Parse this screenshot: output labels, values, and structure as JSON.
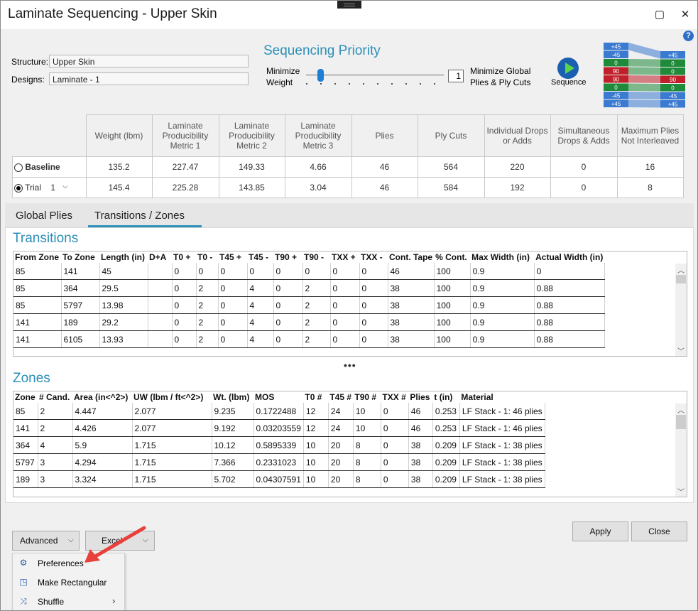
{
  "window": {
    "title": "Laminate Sequencing - Upper Skin"
  },
  "fields": {
    "structure_label": "Structure:",
    "structure_value": "Upper Skin",
    "designs_label": "Designs:",
    "designs_value": "Laminate - 1"
  },
  "priority": {
    "title": "Sequencing Priority",
    "left_label_1": "Minimize",
    "left_label_2": "Weight",
    "right_label_1": "Minimize Global",
    "right_label_2": "Plies & Ply Cuts",
    "slider_value": 1,
    "box_value": "1",
    "sequence_label": "Sequence"
  },
  "stack_icon": {
    "left_plies": [
      "+45",
      "-45",
      "0",
      "90",
      "90",
      "0",
      "-45",
      "+45"
    ],
    "right_plies": [
      "+45",
      "0",
      "0",
      "90",
      "0",
      "-45",
      "+45"
    ]
  },
  "summary": {
    "headers": [
      "Weight (lbm)",
      "Laminate Producibility Metric 1",
      "Laminate Producibility Metric 2",
      "Laminate Producibility Metric 3",
      "Plies",
      "Ply Cuts",
      "Individual Drops or Adds",
      "Simultaneous Drops & Adds",
      "Maximum Plies Not Interleaved"
    ],
    "baseline_label": "Baseline",
    "trial_label": "Trial",
    "trial_select": "1",
    "baseline": [
      "135.2",
      "227.47",
      "149.33",
      "4.66",
      "46",
      "564",
      "220",
      "0",
      "16"
    ],
    "trial": [
      "145.4",
      "225.28",
      "143.85",
      "3.04",
      "46",
      "584",
      "192",
      "0",
      "8"
    ]
  },
  "tabs": [
    {
      "label": "Global Plies"
    },
    {
      "label": "Transitions / Zones"
    }
  ],
  "transitions": {
    "title": "Transitions",
    "headers": [
      "From Zone",
      "To Zone",
      "Length (in)",
      "D+A",
      "T0 +",
      "T0 -",
      "T45 +",
      "T45 -",
      "T90 +",
      "T90 -",
      "TXX +",
      "TXX -",
      "Cont. Tape",
      "% Cont.",
      "Max Width (in)",
      "Actual Width (in)"
    ],
    "rows": [
      [
        "85",
        "141",
        "45",
        "",
        "0",
        "0",
        "0",
        "0",
        "0",
        "0",
        "0",
        "0",
        "46",
        "100",
        "0.9",
        "0"
      ],
      [
        "85",
        "364",
        "29.5",
        "",
        "0",
        "2",
        "0",
        "4",
        "0",
        "2",
        "0",
        "0",
        "38",
        "100",
        "0.9",
        "0.88"
      ],
      [
        "85",
        "5797",
        "13.98",
        "",
        "0",
        "2",
        "0",
        "4",
        "0",
        "2",
        "0",
        "0",
        "38",
        "100",
        "0.9",
        "0.88"
      ],
      [
        "141",
        "189",
        "29.2",
        "",
        "0",
        "2",
        "0",
        "4",
        "0",
        "2",
        "0",
        "0",
        "38",
        "100",
        "0.9",
        "0.88"
      ],
      [
        "141",
        "6105",
        "13.93",
        "",
        "0",
        "2",
        "0",
        "4",
        "0",
        "2",
        "0",
        "0",
        "38",
        "100",
        "0.9",
        "0.88"
      ]
    ],
    "splitter": "•••"
  },
  "zones": {
    "title": "Zones",
    "headers": [
      "Zone",
      "# Cand.",
      "Area (in<^2>)",
      "UW (lbm / ft<^2>)",
      "Wt. (lbm)",
      "MOS",
      "T0 #",
      "T45 #",
      "T90 #",
      "TXX #",
      "Plies",
      "t (in)",
      "Material"
    ],
    "rows": [
      [
        "85",
        "2",
        "4.447",
        "2.077",
        "9.235",
        "0.1722488",
        "12",
        "24",
        "10",
        "0",
        "46",
        "0.253",
        "LF Stack - 1: 46 plies"
      ],
      [
        "141",
        "2",
        "4.426",
        "2.077",
        "9.192",
        "0.03203559",
        "12",
        "24",
        "10",
        "0",
        "46",
        "0.253",
        "LF Stack - 1: 46 plies"
      ],
      [
        "364",
        "4",
        "5.9",
        "1.715",
        "10.12",
        "0.5895339",
        "10",
        "20",
        "8",
        "0",
        "38",
        "0.209",
        "LF Stack - 1: 38 plies"
      ],
      [
        "5797",
        "3",
        "4.294",
        "1.715",
        "7.366",
        "0.2331023",
        "10",
        "20",
        "8",
        "0",
        "38",
        "0.209",
        "LF Stack - 1: 38 plies"
      ],
      [
        "189",
        "3",
        "3.324",
        "1.715",
        "5.702",
        "0.04307591",
        "10",
        "20",
        "8",
        "0",
        "38",
        "0.209",
        "LF Stack - 1: 38 plies"
      ]
    ]
  },
  "buttons": {
    "advanced": "Advanced",
    "excel": "Excel",
    "apply": "Apply",
    "close": "Close"
  },
  "menu": {
    "items": [
      {
        "label": "Preferences"
      },
      {
        "label": "Make Rectangular"
      },
      {
        "label": "Shuffle"
      }
    ]
  },
  "colors": {
    "accent": "#2c8fb8",
    "annotation_arrow": "#e8403a"
  }
}
